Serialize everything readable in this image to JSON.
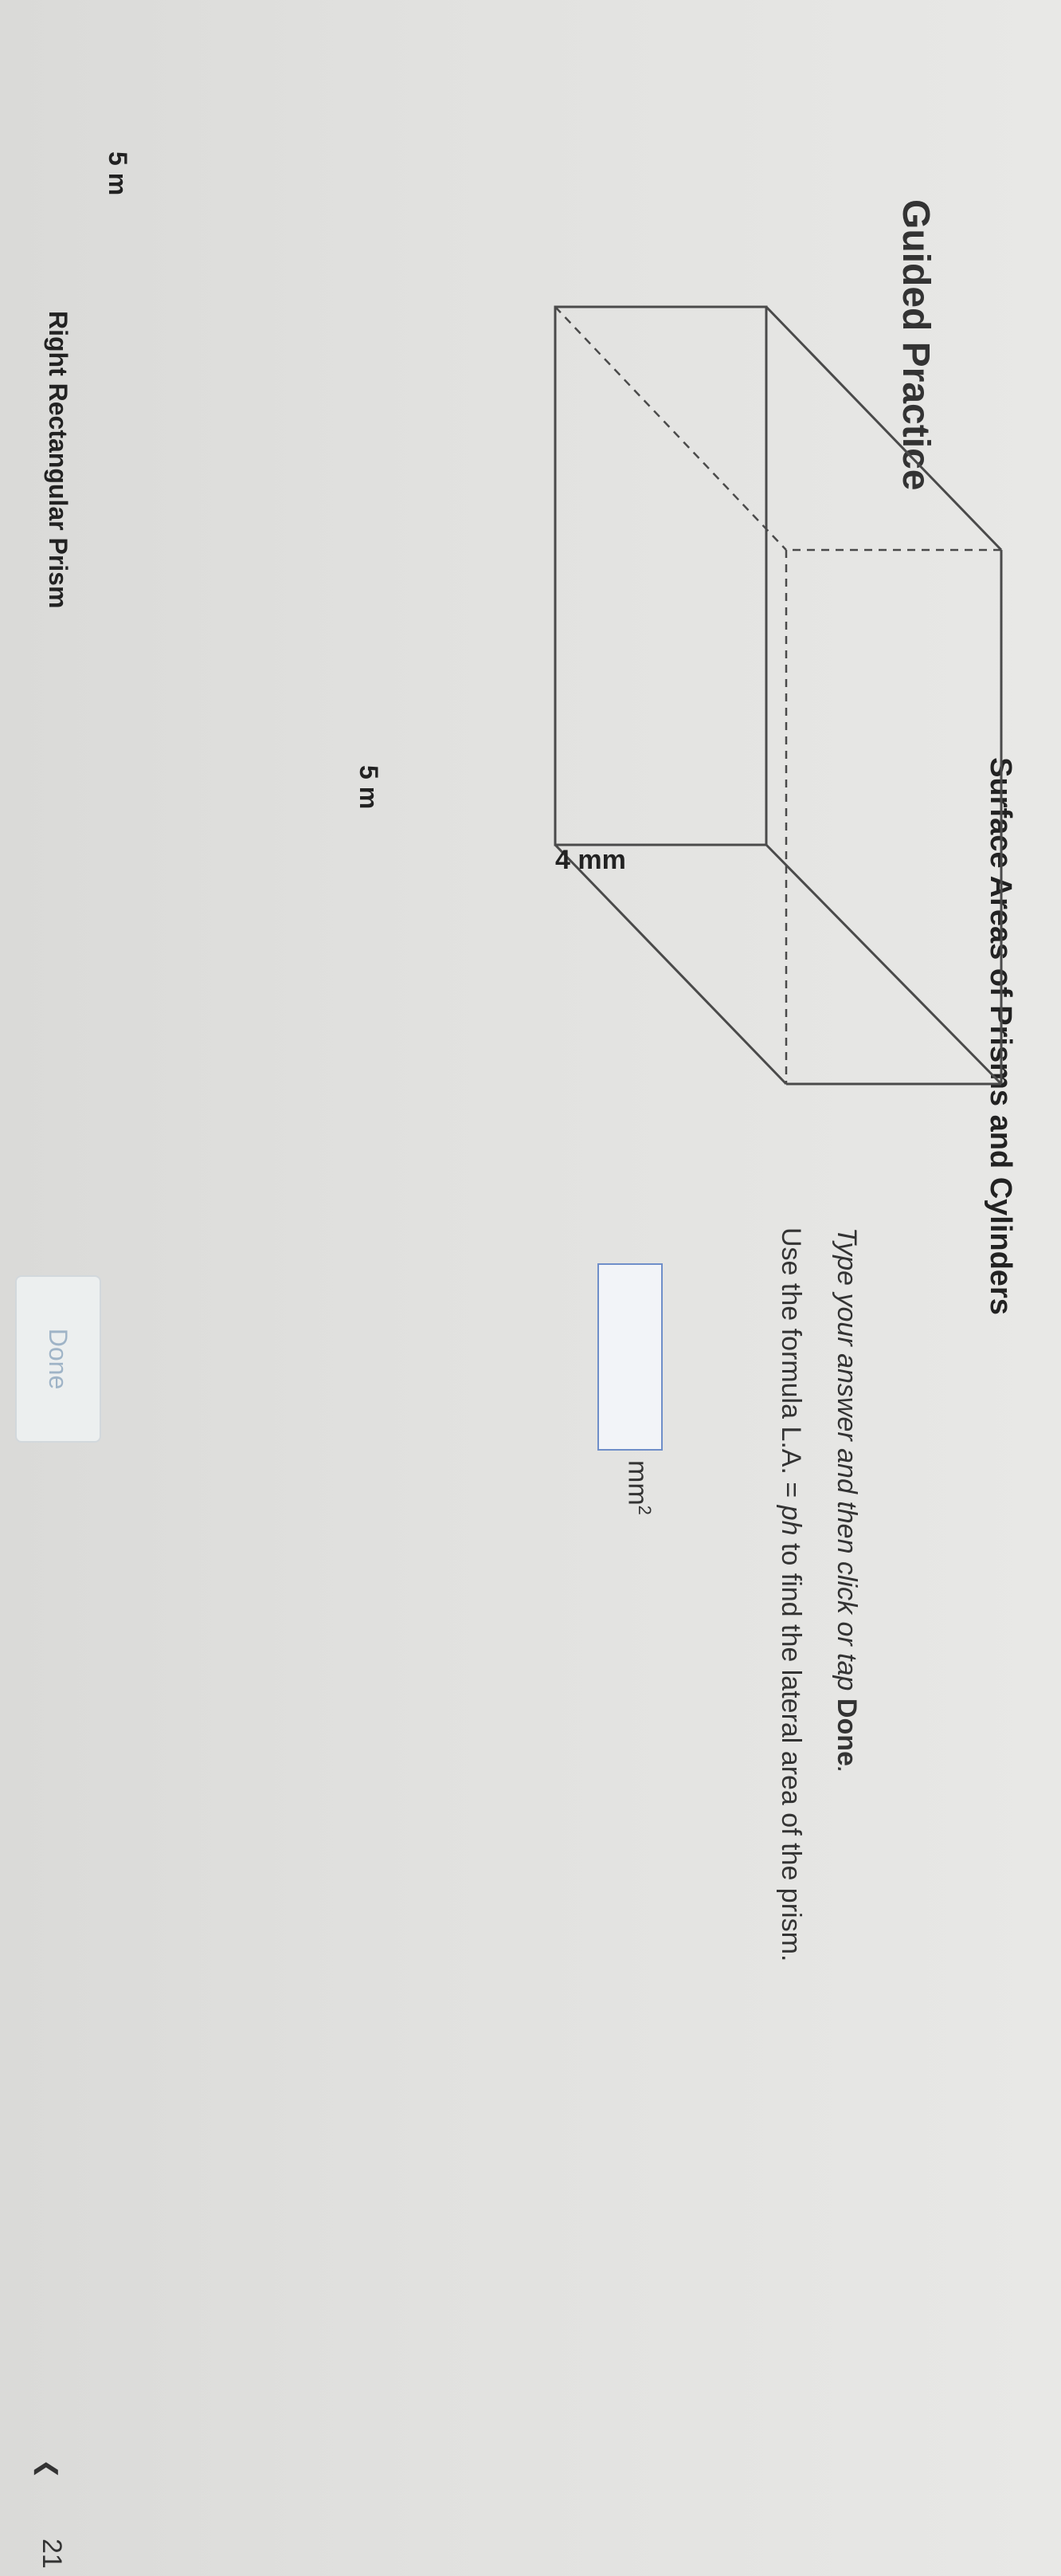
{
  "header": {
    "title": "Surface Areas of Prisms and Cylinders"
  },
  "section": {
    "heading": "Guided Practice"
  },
  "figure": {
    "caption": "Right Rectangular Prism",
    "dimension_labels": {
      "height": "4 mm",
      "depth": "5 m",
      "width": "5 m"
    }
  },
  "question": {
    "instruction_prefix": "Type your answer and then click or tap",
    "instruction_action": "Done",
    "instruction_suffix": ".",
    "prompt_prefix": "Use the formula L.A. =",
    "prompt_formula": "ph",
    "prompt_suffix": "to find the lateral area of the prism."
  },
  "answer": {
    "value": "",
    "unit": "mm",
    "unit_exponent": "2"
  },
  "actions": {
    "done_label": "Done"
  },
  "navigation": {
    "prev_icon": "chevron-left-icon",
    "page_number": "21"
  }
}
